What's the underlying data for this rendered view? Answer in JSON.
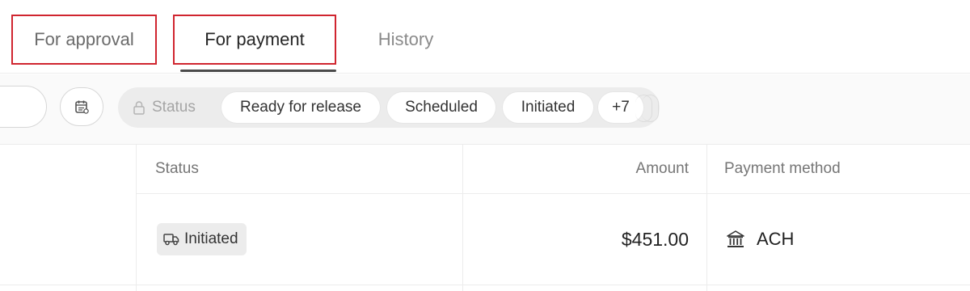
{
  "tabs": [
    {
      "label": "For approval"
    },
    {
      "label": "For payment"
    },
    {
      "label": "History"
    }
  ],
  "filters": {
    "status_label": "Status",
    "chips": [
      "Ready for release",
      "Scheduled",
      "Initiated",
      "+7"
    ]
  },
  "table": {
    "headers": {
      "status": "Status",
      "amount": "Amount",
      "method": "Payment method"
    },
    "rows": [
      {
        "status": "Initiated",
        "amount": "$451.00",
        "method": "ACH"
      }
    ]
  },
  "icons": {
    "calendar": "calendar-icon",
    "lock": "lock-icon",
    "truck": "truck-icon",
    "bank": "bank-icon"
  },
  "colors": {
    "highlight_box": "#d0252f",
    "active_tab_underline": "#4a4a4a"
  }
}
